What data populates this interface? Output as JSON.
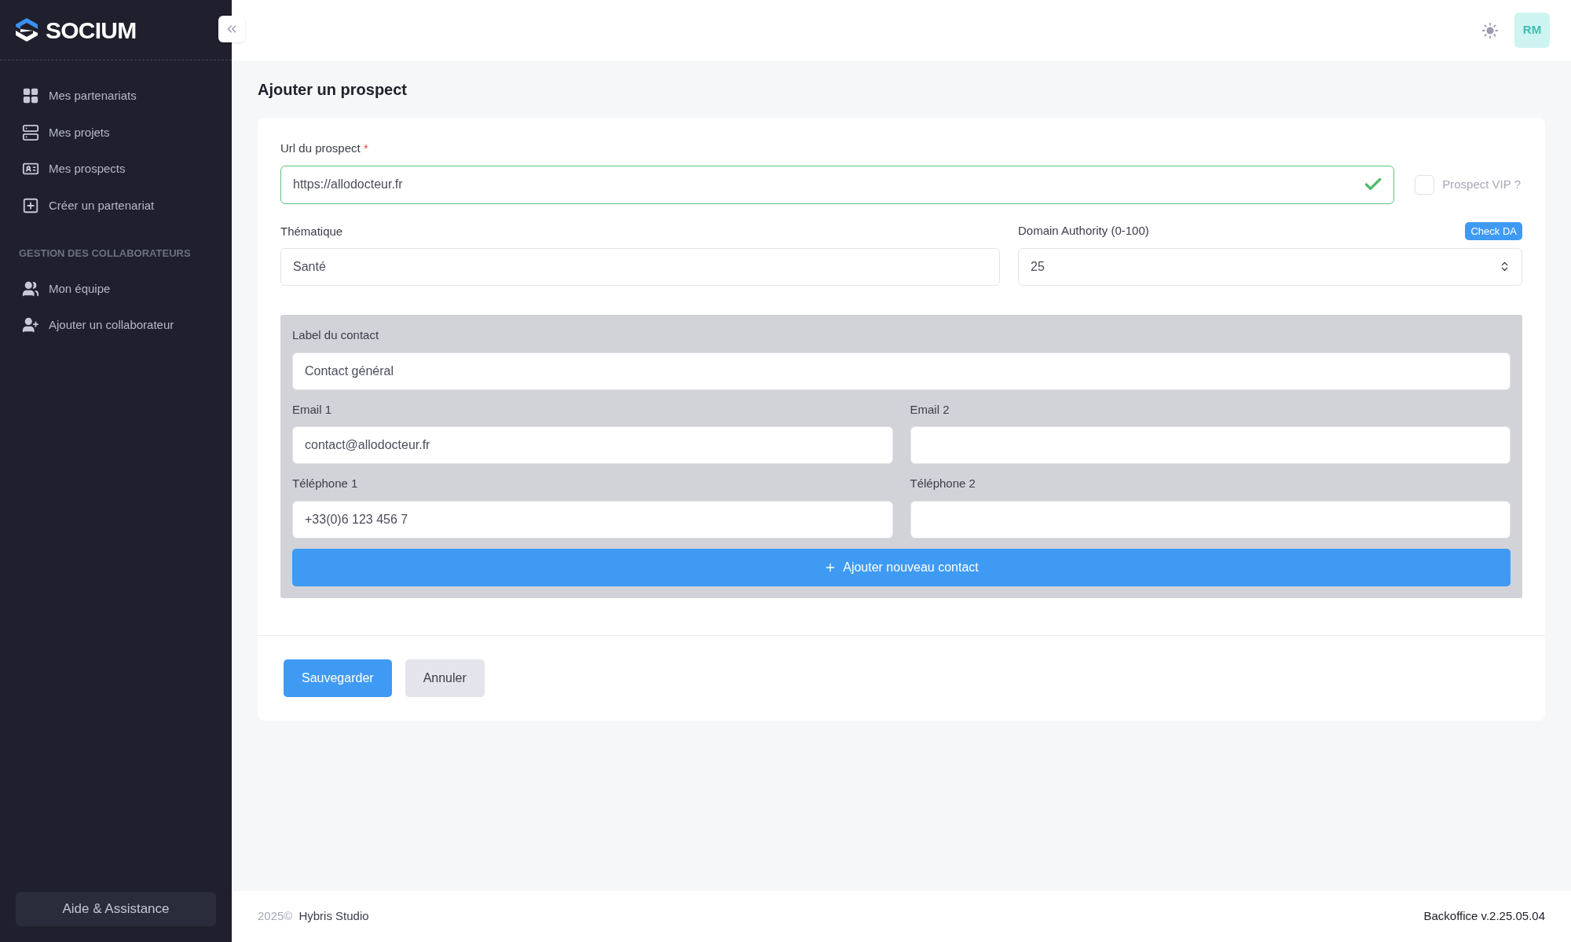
{
  "brand": {
    "name": "SOCIUM"
  },
  "sidebar": {
    "items": [
      {
        "label": "Mes partenariats",
        "kind": "grid",
        "selected": false
      },
      {
        "label": "Mes projets",
        "kind": "servers",
        "selected": false
      },
      {
        "label": "Mes prospects",
        "kind": "idcard",
        "selected": false
      },
      {
        "label": "Créer un partenariat",
        "kind": "gridplus",
        "selected": false
      }
    ],
    "sections": [
      {
        "title": "GESTION DES COLLABORATEURS",
        "items": [
          {
            "label": "Mon équipe",
            "kind": "users",
            "selected": false
          },
          {
            "label": "Ajouter un collaborateur",
            "kind": "userplus",
            "selected": false
          }
        ]
      }
    ],
    "help_button": "Aide & Assistance"
  },
  "header": {
    "avatar": "RM"
  },
  "page": {
    "title": "Ajouter un prospect"
  },
  "form": {
    "url": {
      "label": "Url du prospect",
      "required_mark": "*",
      "value": "https://allodocteur.fr",
      "valid": true
    },
    "vip": {
      "label": "Prospect VIP ?",
      "checked": false
    },
    "thematique": {
      "label": "Thématique",
      "value": "Santé"
    },
    "domain_authority": {
      "label": "Domain Authority (0-100)",
      "value": "25",
      "button": "Check DA"
    },
    "contact": {
      "label": {
        "label": "Label du contact",
        "value": "Contact général"
      },
      "fields": [
        {
          "label": "Email 1",
          "value": "contact@allodocteur.fr"
        },
        {
          "label": "Email 2"
        },
        {
          "label": "Téléphone 1",
          "value": "+33(0)6 123 456 7"
        },
        {
          "label": "Téléphone 2"
        }
      ],
      "add_button": "Ajouter nouveau contact"
    },
    "buttons": [
      {
        "label": "Sauvegarder",
        "kind": "primary"
      },
      {
        "label": "Annuler",
        "kind": "secondary"
      }
    ]
  },
  "footer": {
    "year": "2025©",
    "company": "Hybris Studio",
    "version": "Backoffice v.2.25.05.04"
  }
}
